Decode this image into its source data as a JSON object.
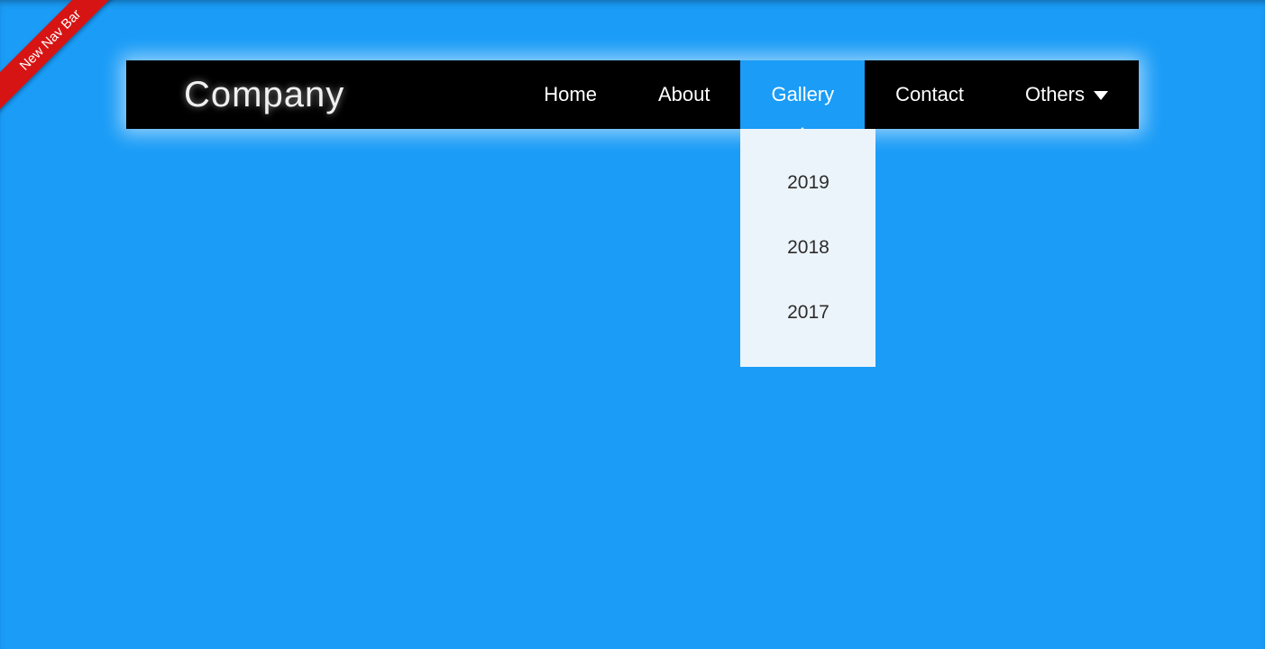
{
  "ribbon": {
    "label": "New Nav Bar"
  },
  "brand": {
    "name": "Company"
  },
  "nav": {
    "items": [
      {
        "label": "Home"
      },
      {
        "label": "About"
      },
      {
        "label": "Gallery",
        "active": true,
        "submenu": [
          {
            "label": "2019"
          },
          {
            "label": "2018"
          },
          {
            "label": "2017"
          }
        ]
      },
      {
        "label": "Contact"
      },
      {
        "label": "Others",
        "has_caret": true
      }
    ]
  }
}
